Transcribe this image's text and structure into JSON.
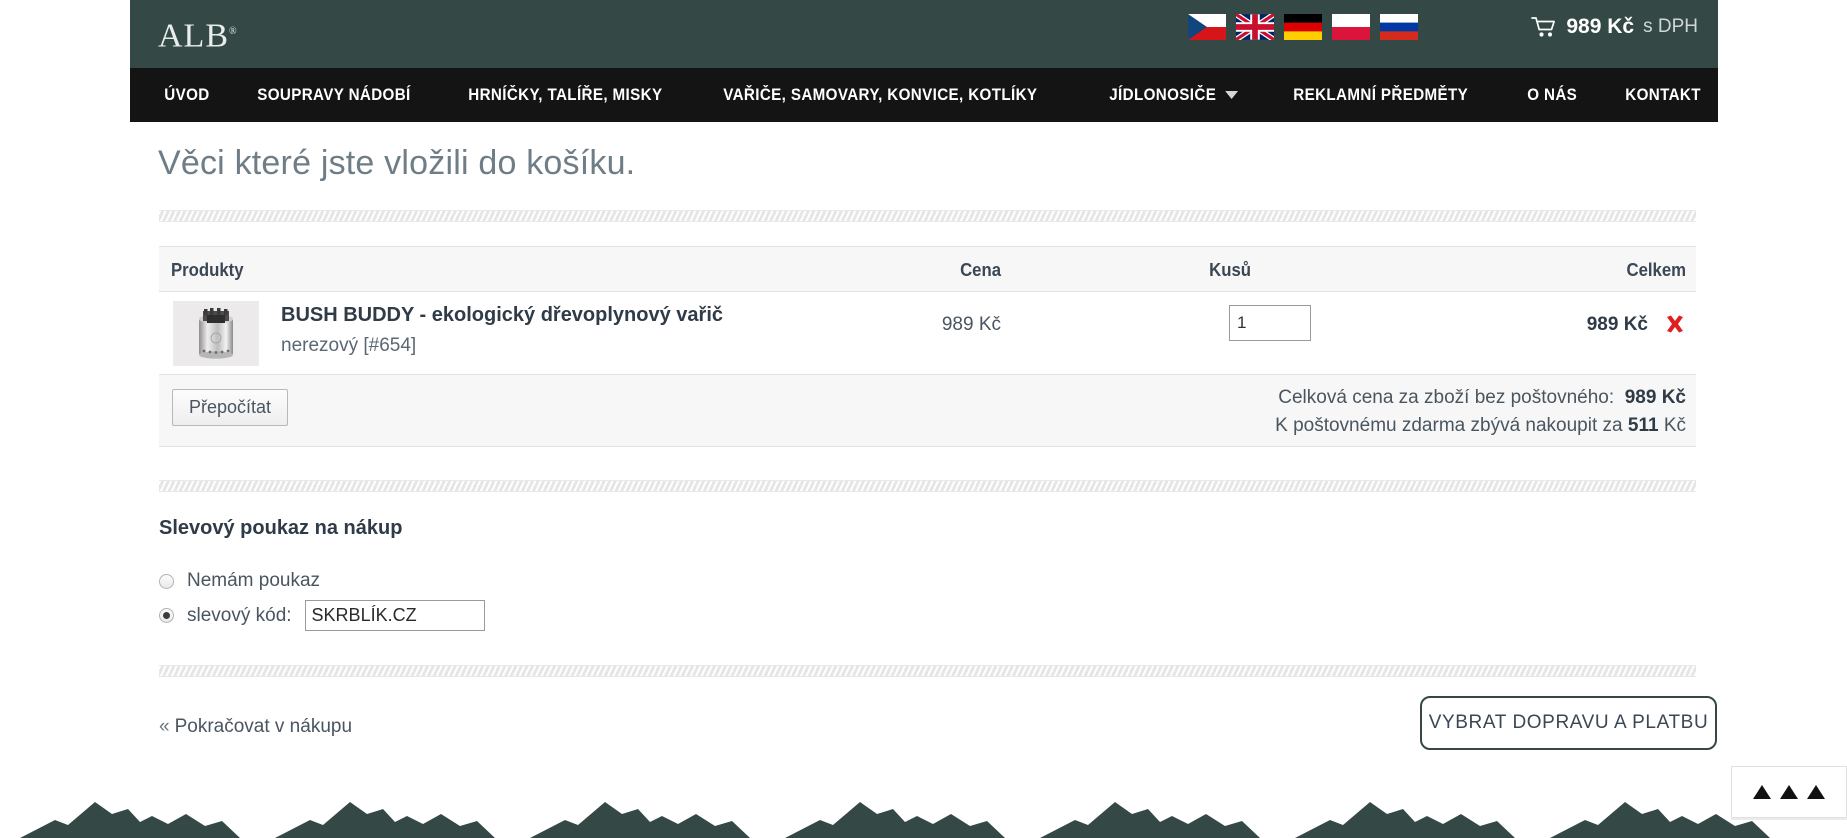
{
  "brand": {
    "logo_text": "ALB",
    "logo_mark": "®"
  },
  "header": {
    "languages": [
      {
        "name": "flag-cz",
        "label": "Čeština"
      },
      {
        "name": "flag-gb",
        "label": "English"
      },
      {
        "name": "flag-de",
        "label": "Deutsch"
      },
      {
        "name": "flag-pl",
        "label": "Polski"
      },
      {
        "name": "flag-ru",
        "label": "Русский"
      }
    ],
    "cart": {
      "icon": "cart-icon",
      "amount": "989 Kč",
      "vat_note": "s DPH"
    },
    "colors": {
      "topbar_bg": "#344945",
      "nav_bg": "#141414",
      "accent": "#344945",
      "delete": "#e02020"
    }
  },
  "nav": {
    "items": [
      {
        "label": "ÚVOD",
        "has_dropdown": false
      },
      {
        "label": "SOUPRAVY NÁDOBÍ",
        "has_dropdown": false
      },
      {
        "label": "HRNÍČKY, TALÍŘE, MISKY",
        "has_dropdown": false
      },
      {
        "label": "VAŘIČE, SAMOVARY, KONVICE, KOTLÍKY",
        "has_dropdown": false
      },
      {
        "label": "JÍDLONOSIČE",
        "has_dropdown": true
      },
      {
        "label": "REKLAMNÍ PŘEDMĚTY",
        "has_dropdown": false
      },
      {
        "label": "O NÁS",
        "has_dropdown": false
      },
      {
        "label": "KONTAKT",
        "has_dropdown": false
      }
    ]
  },
  "page": {
    "title": "Věci které jste vložili do košíku."
  },
  "cart_table": {
    "headers": {
      "products": "Produkty",
      "price": "Cena",
      "quantity": "Kusů",
      "total": "Celkem"
    },
    "rows": [
      {
        "name": "BUSH BUDDY - ekologický dřevoplynový vařič",
        "variant": "nerezový [#654]",
        "price": "989 Kč",
        "quantity": "1",
        "total": "989 Kč",
        "thumbnail": "product-thumbnail-bush-buddy",
        "delete_icon": "delete-x-icon"
      }
    ]
  },
  "summary": {
    "recalc_label": "Přepočítat",
    "total_label": "Celková cena za zboží bez poštovného:",
    "total_value": "989 Kč",
    "shipping_prefix": "K poštovnému zdarma zbývá nakoupit za",
    "shipping_value": "511",
    "shipping_suffix": "Kč"
  },
  "coupon": {
    "title": "Slevový poukaz na nákup",
    "option_none": "Nemám poukaz",
    "option_code": "slevový kód:",
    "code_value": "SKRBLÍK.CZ",
    "code_placeholder": "",
    "selected": "code"
  },
  "actions": {
    "back_chevron": "«",
    "back_label": "Pokračovat v nákupu",
    "cta_label": "VYBRAT DOPRAVU A PLATBU"
  },
  "footer": {
    "scroll_top_icon": "scroll-to-top-triangles"
  }
}
